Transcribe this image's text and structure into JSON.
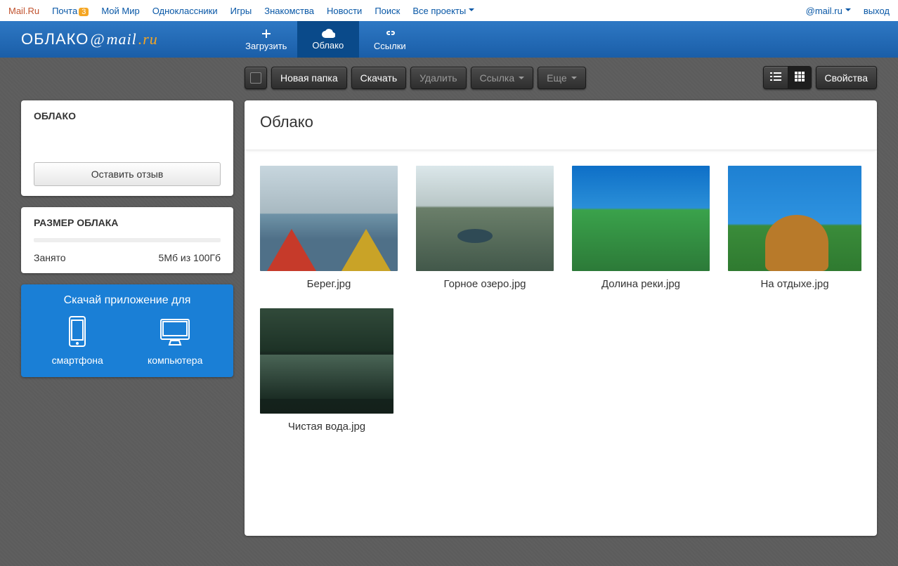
{
  "portal": {
    "links": [
      "Mail.Ru",
      "Почта",
      "Мой Мир",
      "Одноклассники",
      "Игры",
      "Знакомства",
      "Новости",
      "Поиск",
      "Все проекты"
    ],
    "mail_badge": "3",
    "user": "@mail.ru",
    "logout": "выход"
  },
  "logo": {
    "oblako": "ОБЛАКО",
    "at": "@",
    "mail": "mail",
    "dot_ru": ".ru"
  },
  "nav": {
    "upload": "Загрузить",
    "cloud": "Облако",
    "links": "Ссылки"
  },
  "toolbar": {
    "new_folder": "Новая папка",
    "download": "Скачать",
    "delete": "Удалить",
    "link": "Ссылка",
    "more": "Еще",
    "properties": "Свойства"
  },
  "sidebar": {
    "cloud_title": "ОБЛАКО",
    "review_btn": "Оставить отзыв",
    "size_title": "РАЗМЕР ОБЛАКА",
    "used_label": "Занято",
    "used_value": "5Мб из 100Гб",
    "promo_title": "Скачай приложение для",
    "promo_phone": "смартфона",
    "promo_pc": "компьютера"
  },
  "main": {
    "title": "Облако",
    "files": [
      {
        "name": "Берег.jpg"
      },
      {
        "name": "Горное озеро.jpg"
      },
      {
        "name": "Долина реки.jpg"
      },
      {
        "name": "На отдыхе.jpg"
      },
      {
        "name": "Чистая вода.jpg"
      }
    ]
  }
}
